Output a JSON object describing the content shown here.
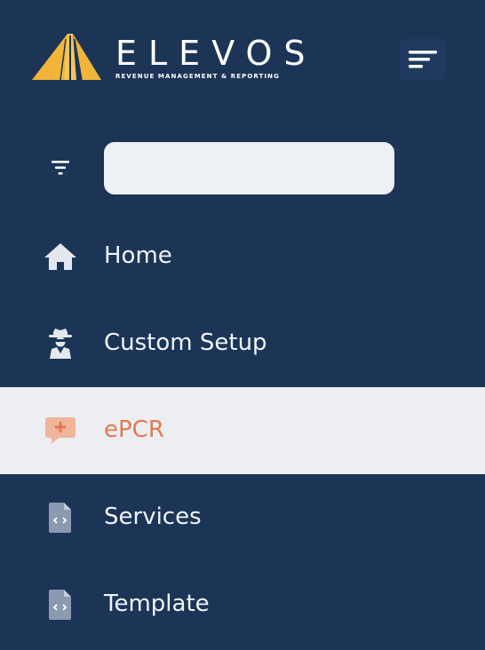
{
  "brand": {
    "name": "ELEVOS",
    "tagline": "REVENUE MANAGEMENT & REPORTING"
  },
  "search": {
    "value": "",
    "placeholder": ""
  },
  "nav": {
    "items": [
      {
        "label": "Home",
        "icon": "home-icon",
        "active": false
      },
      {
        "label": "Custom Setup",
        "icon": "detective-icon",
        "active": false
      },
      {
        "label": "ePCR",
        "icon": "medical-chat-icon",
        "active": true
      },
      {
        "label": "Services",
        "icon": "code-file-icon",
        "active": false
      },
      {
        "label": "Template",
        "icon": "code-file-icon",
        "active": false
      }
    ]
  },
  "colors": {
    "sidebar_bg": "#1c3557",
    "active_bg": "#eceef2",
    "active_text": "#e07a52",
    "logo_gold": "#f2b53a",
    "text": "#f1f4f8"
  }
}
